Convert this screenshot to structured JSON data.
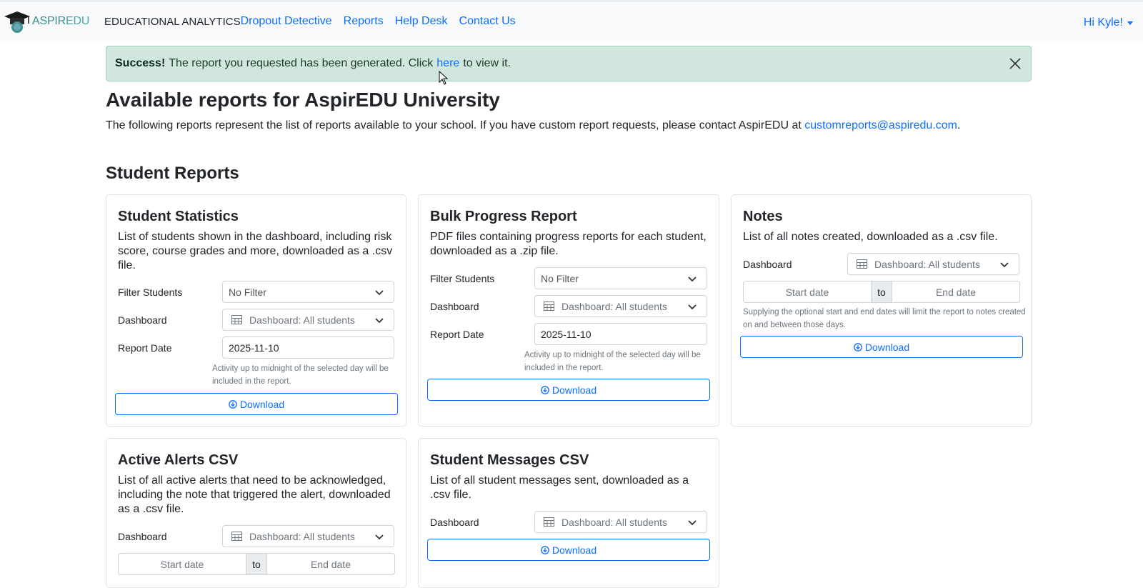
{
  "brand": {
    "name_part1": "ASPIR",
    "name_part2": "EDU",
    "tagline": "EDUCATIONAL ANALYTICS"
  },
  "nav": {
    "links": [
      "Dropout Detective",
      "Reports",
      "Help Desk",
      "Contact Us"
    ],
    "user": "Hi Kyle!"
  },
  "alert": {
    "strong": "Success!",
    "text_before": "The report you requested has been generated. Click",
    "link": "here",
    "text_after": "to view it."
  },
  "page": {
    "title": "Available reports for AspirEDU University",
    "intro": "The following reports represent the list of reports available to your school. If you have custom report requests, please contact AspirEDU at",
    "email": "customreports@aspiredu.com",
    "intro_end": ".",
    "section": "Student Reports"
  },
  "labels": {
    "filter": "Filter Students",
    "dashboard": "Dashboard",
    "report_date": "Report Date",
    "no_filter": "No Filter",
    "dashboard_value": "Dashboard: All students",
    "date_value": "2025-11-10",
    "start": "Start date",
    "to": "to",
    "end": "End date",
    "download": "Download",
    "activity_help": "Activity up to midnight of the selected day will be included in the report.",
    "notes_help": "Supplying the optional start and end dates will limit the report to notes created on and between those days."
  },
  "cards": {
    "stats": {
      "title": "Student Statistics",
      "desc": "List of students shown in the dashboard, including risk score, course grades and more, downloaded as a .csv file."
    },
    "bulk": {
      "title": "Bulk Progress Report",
      "desc": "PDF files containing progress reports for each student, downloaded as a .zip file."
    },
    "notes": {
      "title": "Notes",
      "desc": "List of all notes created, downloaded as a .csv file."
    },
    "alerts": {
      "title": "Active Alerts CSV",
      "desc": "List of all active alerts that need to be acknowledged, including the note that triggered the alert, downloaded as a .csv file."
    },
    "messages": {
      "title": "Student Messages CSV",
      "desc": "List of all student messages sent, downloaded as a .csv file."
    }
  }
}
